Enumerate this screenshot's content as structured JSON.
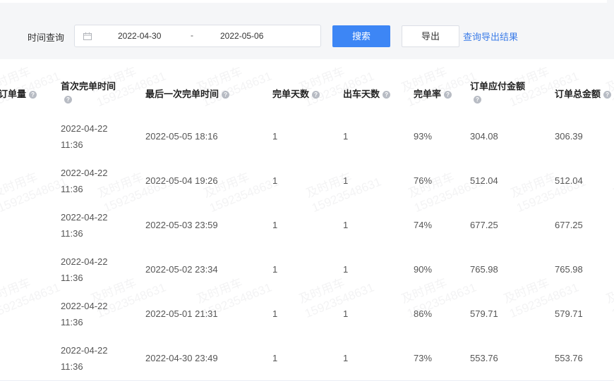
{
  "filter": {
    "time_label": "时间查询",
    "date_start": "2022-04-30",
    "date_separator": "-",
    "date_end": "2022-05-06",
    "search_label": "搜索",
    "export_label": "导出",
    "results_link": "查询导出结果"
  },
  "table": {
    "headers": [
      {
        "label": "订单量",
        "help": "?"
      },
      {
        "label": "首次完单时间",
        "help": "?"
      },
      {
        "label": "最后一次完单时间",
        "help": "?"
      },
      {
        "label": "完单天数",
        "help": "?"
      },
      {
        "label": "出车天数",
        "help": "?"
      },
      {
        "label": "完单率",
        "help": "?"
      },
      {
        "label": "订单应付金额",
        "help": "?"
      },
      {
        "label": "订单总金额",
        "help": "?"
      }
    ],
    "rows": [
      {
        "first_done": "2022-04-22 11:36",
        "last_done": "2022-05-05 18:16",
        "done_days": "1",
        "drive_days": "1",
        "rate": "93%",
        "payable": "304.08",
        "total": "306.39"
      },
      {
        "first_done": "2022-04-22 11:36",
        "last_done": "2022-05-04 19:26",
        "done_days": "1",
        "drive_days": "1",
        "rate": "76%",
        "payable": "512.04",
        "total": "512.04"
      },
      {
        "first_done": "2022-04-22 11:36",
        "last_done": "2022-05-03 23:59",
        "done_days": "1",
        "drive_days": "1",
        "rate": "74%",
        "payable": "677.25",
        "total": "677.25"
      },
      {
        "first_done": "2022-04-22 11:36",
        "last_done": "2022-05-02 23:34",
        "done_days": "1",
        "drive_days": "1",
        "rate": "90%",
        "payable": "765.98",
        "total": "765.98"
      },
      {
        "first_done": "2022-04-22 11:36",
        "last_done": "2022-05-01 21:31",
        "done_days": "1",
        "drive_days": "1",
        "rate": "86%",
        "payable": "579.71",
        "total": "579.71"
      },
      {
        "first_done": "2022-04-22 11:36",
        "last_done": "2022-04-30 23:49",
        "done_days": "1",
        "drive_days": "1",
        "rate": "73%",
        "payable": "553.76",
        "total": "553.76"
      }
    ]
  },
  "watermark": {
    "line1": "及时用车",
    "line2": "15923548631"
  },
  "colors": {
    "primary": "#3d86f5",
    "link": "#3d7de8",
    "filter_bg": "#f5f6f8",
    "border": "#ebeef5"
  }
}
